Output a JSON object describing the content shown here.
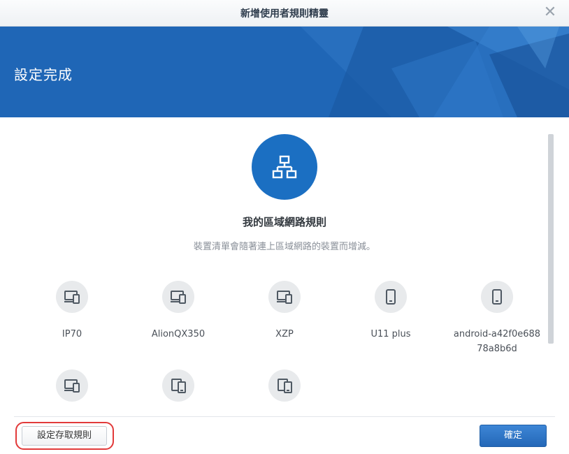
{
  "window": {
    "title": "新增使用者規則精靈",
    "close_icon": "close-icon"
  },
  "banner": {
    "title": "設定完成",
    "color": "#1f66b6"
  },
  "rule": {
    "icon": "network-icon",
    "title": "我的區域網路規則",
    "description": "裝置清單會隨著連上區域網路的裝置而增減。"
  },
  "devices": [
    {
      "name": "IP70",
      "icon": "laptop-phone-icon"
    },
    {
      "name": "AlionQX350",
      "icon": "laptop-phone-icon"
    },
    {
      "name": "XZP",
      "icon": "laptop-phone-icon"
    },
    {
      "name": "U11 plus",
      "icon": "smartphone-icon"
    },
    {
      "name": "android-a42f0e68878a8b6d",
      "icon": "smartphone-icon"
    },
    {
      "name": "",
      "icon": "laptop-phone-icon"
    },
    {
      "name": "",
      "icon": "devices-icon"
    },
    {
      "name": "",
      "icon": "devices-icon"
    }
  ],
  "footer": {
    "rules_button": "設定存取規則",
    "ok_button": "確定",
    "accent": "#2468b8",
    "highlight": "#e23a3a"
  }
}
